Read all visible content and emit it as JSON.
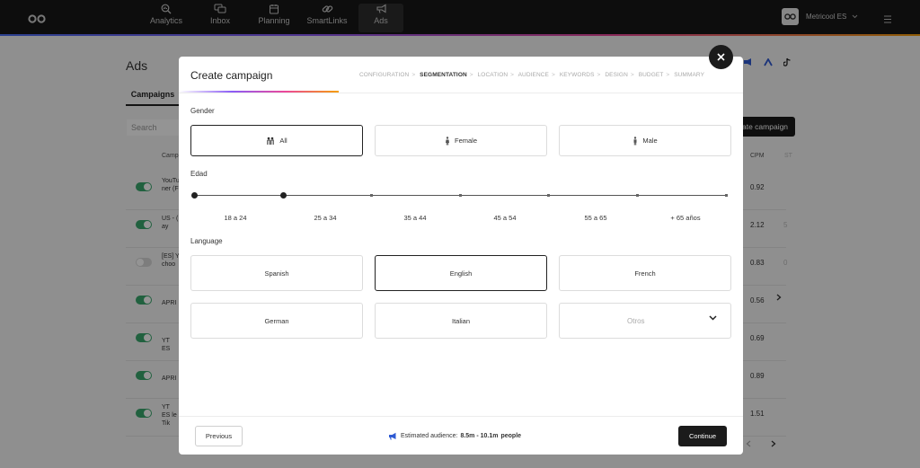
{
  "nav": {
    "items": [
      {
        "label": "Analytics",
        "icon": "analytics-icon"
      },
      {
        "label": "Inbox",
        "icon": "inbox-icon"
      },
      {
        "label": "Planning",
        "icon": "calendar-icon"
      },
      {
        "label": "SmartLinks",
        "icon": "link-icon"
      },
      {
        "label": "Ads",
        "icon": "megaphone-icon"
      }
    ],
    "active": "Ads",
    "account_name": "Metricool ES"
  },
  "background": {
    "title": "Ads",
    "tab": "Campaigns",
    "search_placeholder": "Search",
    "create_button": "ate campaign",
    "col_campaign": "Camp",
    "col_cpm": "CPM",
    "col_extra": "ST",
    "rows": [
      {
        "name": "YouTu ner (F",
        "cpm": "0.92",
        "extra": "",
        "active": true
      },
      {
        "name": "US - ( ay",
        "cpm": "2.12",
        "extra": "5",
        "active": true
      },
      {
        "name": "[ES] Y choo",
        "cpm": "0.83",
        "extra": "0",
        "active": false
      },
      {
        "name": "APRI",
        "cpm": "0.56",
        "extra": "",
        "active": true
      },
      {
        "name": "YT ES",
        "cpm": "0.69",
        "extra": "",
        "active": true
      },
      {
        "name": "APRI",
        "cpm": "0.89",
        "extra": "",
        "active": true
      },
      {
        "name": "YT ES le Tik",
        "cpm": "1.51",
        "extra": "",
        "active": true
      }
    ]
  },
  "modal": {
    "title": "Create campaign",
    "steps": [
      "CONFIGURATION",
      "SEGMENTATION",
      "LOCATION",
      "AUDIENCE",
      "KEYWORDS",
      "DESIGN",
      "BUDGET",
      "SUMMARY"
    ],
    "current_step": "SEGMENTATION",
    "gender": {
      "label": "Gender",
      "options": [
        "All",
        "Female",
        "Male"
      ],
      "selected": "All"
    },
    "age": {
      "label": "Edad",
      "ranges": [
        "18 a 24",
        "25 a 34",
        "35 a 44",
        "45 a 54",
        "55 a 65",
        "+ 65 años"
      ],
      "selected_from": "18 a 24",
      "selected_to": "25 a 34"
    },
    "language": {
      "label": "Language",
      "options": [
        "Spanish",
        "English",
        "French",
        "German",
        "Italian"
      ],
      "selected": "English",
      "other_placeholder": "Otros"
    },
    "footer": {
      "previous": "Previous",
      "audience_label": "Estimated audience:",
      "audience_value": "8.5m - 10.1m",
      "audience_unit": "people",
      "continue": "Continue"
    }
  },
  "colors": {
    "accent_green": "#3aa76d",
    "dark": "#1b1b1b",
    "audience_icon": "#2f5bd3"
  }
}
